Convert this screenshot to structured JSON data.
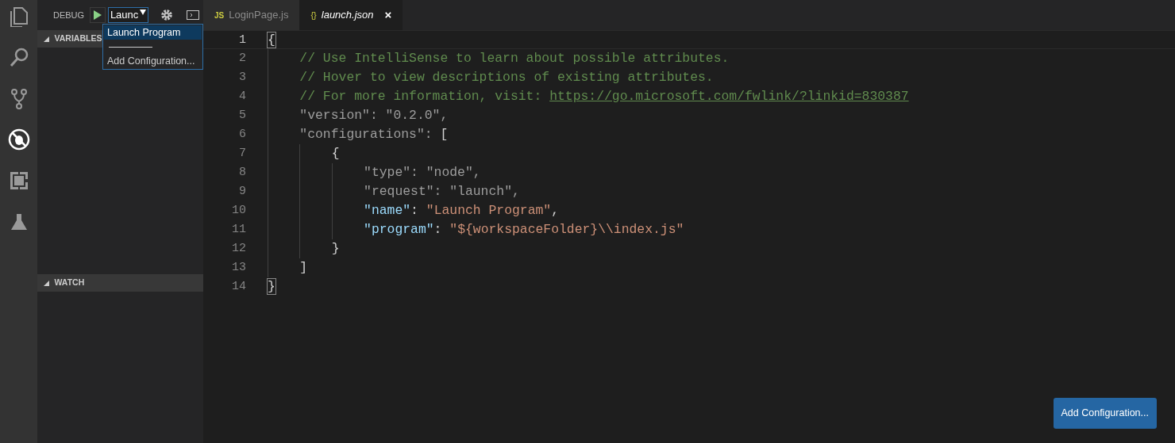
{
  "activity_bar": [
    {
      "kind": "files",
      "selected": false
    },
    {
      "kind": "search",
      "selected": false
    },
    {
      "kind": "git",
      "selected": false
    },
    {
      "kind": "debug",
      "selected": true
    },
    {
      "kind": "extensions",
      "selected": false
    },
    {
      "kind": "test",
      "selected": false
    }
  ],
  "debug_toolbar": {
    "label": "DEBUG",
    "config_select": {
      "value": "Launc"
    }
  },
  "config_dropdown": {
    "options": [
      {
        "kind": "option",
        "label": "Launch Program",
        "selected": true
      },
      {
        "kind": "separator"
      },
      {
        "kind": "option",
        "label": "Add Configuration...",
        "selected": false
      }
    ]
  },
  "sections": [
    {
      "title": "VARIABLES",
      "expanded": true
    },
    {
      "title": "WATCH",
      "expanded": true
    }
  ],
  "tabs": [
    {
      "kind": "js",
      "icon_text": "JS",
      "label": "LoginPage.js",
      "selected": false
    },
    {
      "kind": "json",
      "icon_text": "{}",
      "label": "launch.json",
      "selected": true,
      "close": "×"
    }
  ],
  "editor": {
    "lines": [
      {
        "number": "1",
        "current": true,
        "tokens": [
          {
            "kind": "bracket-match",
            "text": "{"
          }
        ]
      },
      {
        "number": "2",
        "current": false,
        "tokens": [
          {
            "kind": "comment",
            "text": "    // Use IntelliSense to learn about possible attributes."
          }
        ]
      },
      {
        "number": "3",
        "current": false,
        "tokens": [
          {
            "kind": "comment",
            "text": "    // Hover to view descriptions of existing attributes."
          }
        ]
      },
      {
        "number": "4",
        "current": false,
        "tokens": [
          {
            "kind": "comment",
            "text": "    // For more information, visit: "
          },
          {
            "kind": "link",
            "text": "https://go.microsoft.com/fwlink/?linkid=830387"
          }
        ]
      },
      {
        "number": "5",
        "current": false,
        "tokens": [
          {
            "kind": "dim",
            "text": "    \"version\": \"0.2.0\","
          }
        ]
      },
      {
        "number": "6",
        "current": false,
        "tokens": [
          {
            "kind": "dim",
            "text": "    \"configurations\": "
          },
          {
            "kind": "punct",
            "text": "["
          }
        ]
      },
      {
        "number": "7",
        "current": false,
        "tokens": [
          {
            "kind": "punct",
            "text": "        {"
          }
        ]
      },
      {
        "number": "8",
        "current": false,
        "tokens": [
          {
            "kind": "dim",
            "text": "            \"type\": \"node\","
          }
        ]
      },
      {
        "number": "9",
        "current": false,
        "tokens": [
          {
            "kind": "dim",
            "text": "            \"request\": \"launch\","
          }
        ]
      },
      {
        "number": "10",
        "current": false,
        "tokens": [
          {
            "kind": "key",
            "text": "            \"name\""
          },
          {
            "kind": "punct",
            "text": ": "
          },
          {
            "kind": "string",
            "text": "\"Launch Program\""
          },
          {
            "kind": "punct",
            "text": ","
          }
        ]
      },
      {
        "number": "11",
        "current": false,
        "tokens": [
          {
            "kind": "key",
            "text": "            \"program\""
          },
          {
            "kind": "punct",
            "text": ": "
          },
          {
            "kind": "string",
            "text": "\"${workspaceFolder}\\\\index.js\""
          }
        ]
      },
      {
        "number": "12",
        "current": false,
        "tokens": [
          {
            "kind": "punct",
            "text": "        }"
          }
        ]
      },
      {
        "number": "13",
        "current": false,
        "tokens": [
          {
            "kind": "punct",
            "text": "    ]"
          }
        ]
      },
      {
        "number": "14",
        "current": false,
        "tokens": [
          {
            "kind": "bracket-match",
            "text": "}"
          }
        ]
      }
    ]
  },
  "add_configuration_button": {
    "label": "Add Configuration..."
  }
}
